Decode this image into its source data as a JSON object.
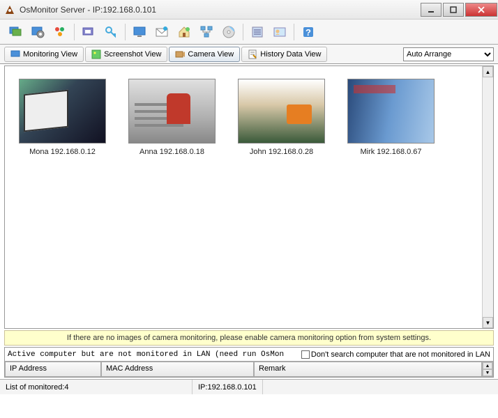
{
  "window": {
    "title": "OsMonitor Server -  IP:192.168.0.101"
  },
  "view_tabs": {
    "monitoring": "Monitoring View",
    "screenshot": "Screenshot View",
    "camera": "Camera View",
    "history": "History Data View"
  },
  "arrange_select": {
    "value": "Auto Arrange"
  },
  "cameras": [
    {
      "label": "Mona 192.168.0.12"
    },
    {
      "label": "Anna 192.168.0.18"
    },
    {
      "label": "John 192.168.0.28"
    },
    {
      "label": "Mirk 192.168.0.67"
    }
  ],
  "info_message": "If there are no images of camera monitoring, please enable camera monitoring option from system settings.",
  "bottom_panel": {
    "status_text": "Active computer but are not monitored in LAN (need run OsMon",
    "checkbox_label": "Don't search computer that are not monitored in LAN",
    "headers": {
      "ip": "IP Address",
      "mac": "MAC Address",
      "remark": "Remark"
    }
  },
  "statusbar": {
    "monitored": "List of monitored:4",
    "ip": "IP:192.168.0.101"
  },
  "icons": {
    "toolbar": [
      "monitor-icon",
      "settings-icon",
      "users-icon",
      "screenshot-icon",
      "key-icon",
      "display-icon",
      "mail-icon",
      "home-icon",
      "network-icon",
      "disc-icon",
      "list-icon",
      "user-card-icon",
      "help-icon"
    ]
  }
}
